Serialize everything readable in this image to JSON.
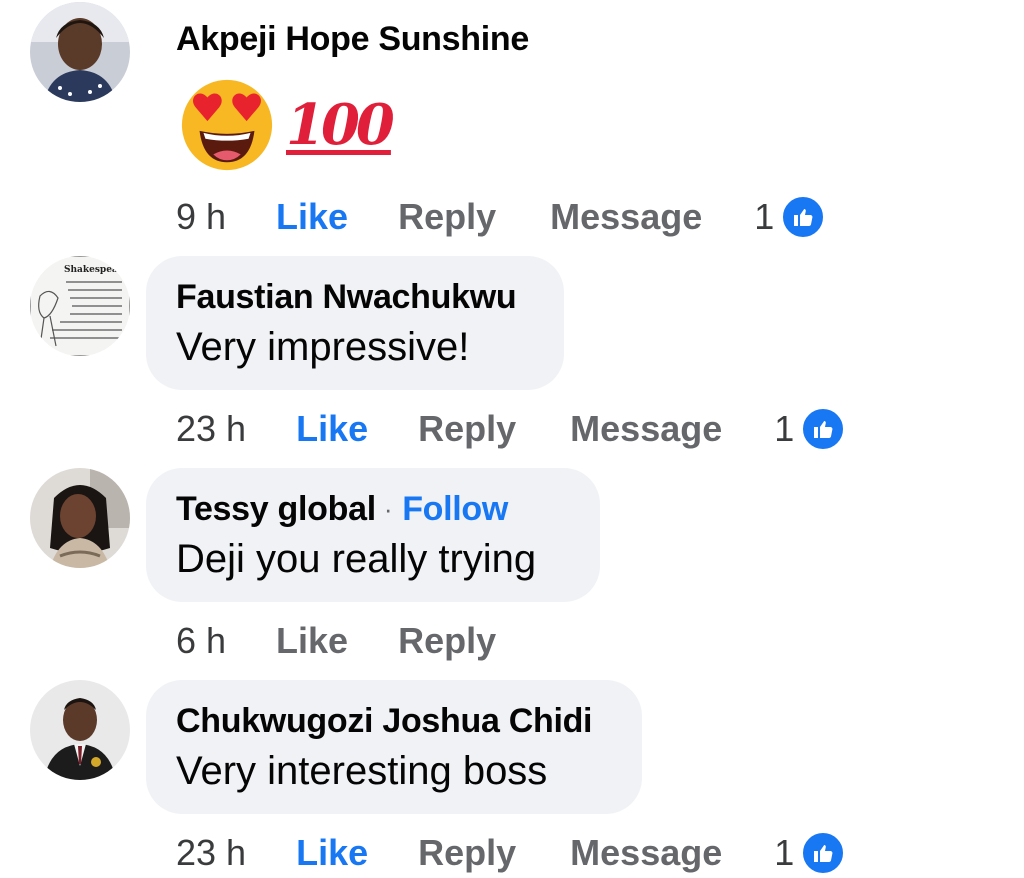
{
  "comments": [
    {
      "author": "Akpeji Hope Sunshine",
      "text": "",
      "emoji": [
        "heart-eyes-emoji",
        "hundred-points-emoji"
      ],
      "hundred_text": "100",
      "time": "9 h",
      "like_label": "Like",
      "like_active": true,
      "reply_label": "Reply",
      "message_label": "Message",
      "reaction_count": "1"
    },
    {
      "author": "Faustian Nwachukwu",
      "text": "Very impressive!",
      "avatar_text": "Shakespeare s...",
      "time": "23 h",
      "like_label": "Like",
      "like_active": true,
      "reply_label": "Reply",
      "message_label": "Message",
      "reaction_count": "1"
    },
    {
      "author": "Tessy global",
      "separator": "·",
      "follow_label": "Follow",
      "text": "Deji you really trying",
      "time": "6 h",
      "like_label": "Like",
      "like_active": false,
      "reply_label": "Reply"
    },
    {
      "author": "Chukwugozi Joshua Chidi",
      "text": "Very interesting boss",
      "time": "23 h",
      "like_label": "Like",
      "like_active": true,
      "reply_label": "Reply",
      "message_label": "Message",
      "reaction_count": "1"
    }
  ],
  "colors": {
    "accent": "#1877f2",
    "bubble": "#f0f2f5",
    "muted": "#65676b"
  }
}
